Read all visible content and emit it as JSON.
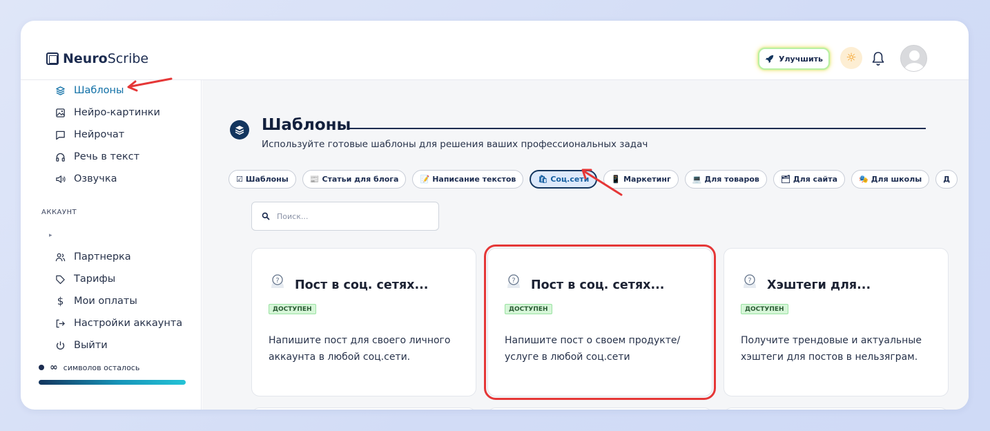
{
  "app": {
    "logo_bold": "Neuro",
    "logo_regular": "Scribe"
  },
  "header": {
    "upgrade_label": "Улучшить"
  },
  "sidebar": {
    "items": [
      {
        "label": "Шаблоны",
        "icon": "layers-icon",
        "active": true
      },
      {
        "label": "Нейро-картинки",
        "icon": "image-icon"
      },
      {
        "label": "Нейрочат",
        "icon": "chat-icon"
      },
      {
        "label": "Речь в текст",
        "icon": "headphones-icon"
      },
      {
        "label": "Озвучка",
        "icon": "speaker-icon"
      }
    ],
    "section_label": "АККАУНТ",
    "account_items": [
      {
        "label": "Партнерка",
        "icon": "users-icon"
      },
      {
        "label": "Тарифы",
        "icon": "tag-icon"
      },
      {
        "label": "Мои оплаты",
        "icon": "dollar-icon"
      },
      {
        "label": "Настройки аккаунта",
        "icon": "login-icon"
      },
      {
        "label": "Выйти",
        "icon": "power-icon"
      }
    ],
    "chars_symbol": "∞",
    "chars_label": "символов осталось"
  },
  "main": {
    "title": "Шаблоны",
    "subtitle": "Используйте готовые шаблоны для решения ваших профессиональных задач",
    "chips": [
      {
        "icon": "☑",
        "label": "Шаблоны"
      },
      {
        "icon": "📰",
        "label": "Статьи для блога"
      },
      {
        "icon": "📝",
        "label": "Написание текстов"
      },
      {
        "icon": "🛍",
        "label": "Соц.сети",
        "active": true
      },
      {
        "icon": "📱",
        "label": "Маркетинг"
      },
      {
        "icon": "💻",
        "label": "Для товаров"
      },
      {
        "icon": "🗂",
        "label": "Для сайта"
      },
      {
        "icon": "🎭",
        "label": "Для школы"
      },
      {
        "icon": "",
        "label": "Д"
      }
    ],
    "search_placeholder": "Поиск...",
    "cards": [
      {
        "title": "Пост в соц. сетях...",
        "badge": "ДОСТУПЕН",
        "description": "Напишите пост для своего личного аккаунта в любой соц.сети."
      },
      {
        "title": "Пост в соц. сетях...",
        "badge": "ДОСТУПЕН",
        "description": "Напишите пост о своем продукте/ услуге в любой соц.сети"
      },
      {
        "title": "Хэштеги для...",
        "badge": "ДОСТУПЕН",
        "description": "Получите трендовые и актуальные хэштеги для постов в нельзяграм."
      }
    ]
  },
  "colors": {
    "brand": "#13355e",
    "accent": "#0f6fa6",
    "annotation": "#e53737"
  }
}
